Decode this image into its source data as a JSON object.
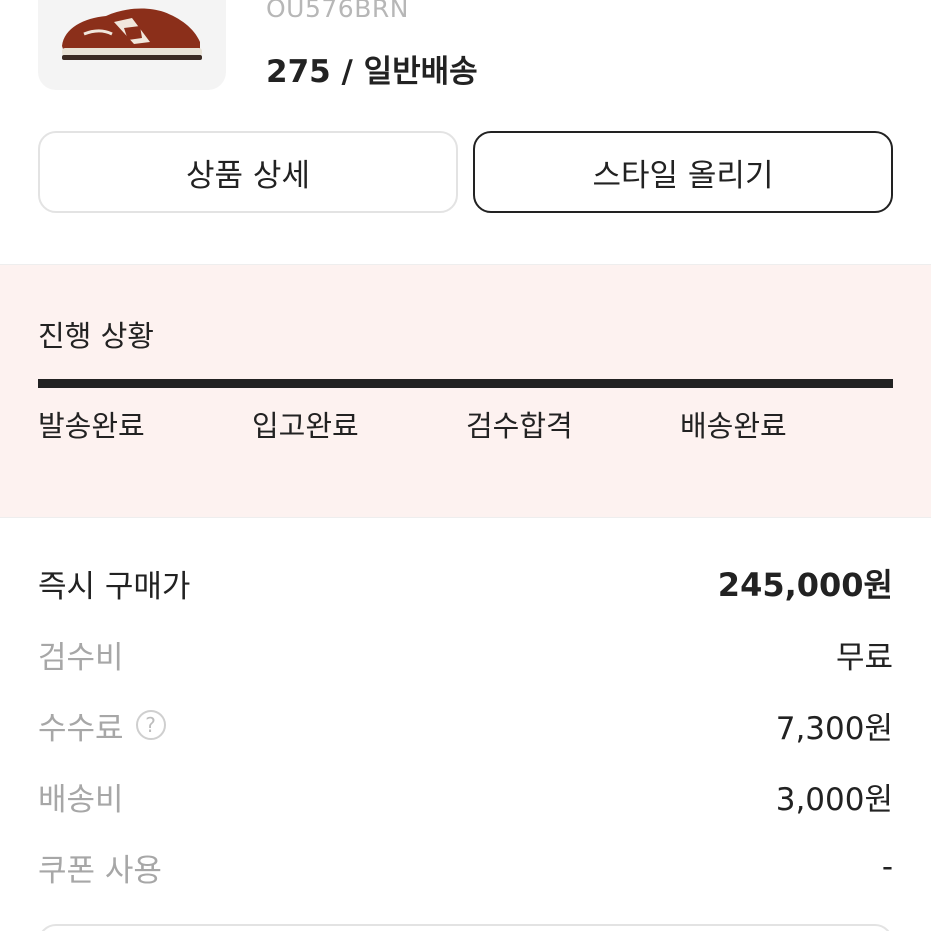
{
  "product": {
    "model_number": "OU576BRN",
    "size_shipping": "275 / 일반배송",
    "image_icon": "sneaker-image"
  },
  "buttons": {
    "detail_label": "상품 상세",
    "style_label": "스타일 올리기"
  },
  "progress": {
    "title": "진행 상황",
    "steps": [
      "발송완료",
      "입고완료",
      "검수합격",
      "배송완료"
    ],
    "completion": 1.0,
    "background_color": "#fdf2f0",
    "bar_color": "#222222"
  },
  "pricing": {
    "rows": [
      {
        "label": "즉시 구매가",
        "value": "245,000원"
      },
      {
        "label": "검수비",
        "value": "무료"
      },
      {
        "label": "수수료",
        "value": "7,300원",
        "icon": "help-icon",
        "icon_glyph": "?"
      },
      {
        "label": "배송비",
        "value": "3,000원"
      },
      {
        "label": "쿠폰 사용",
        "value": "-"
      }
    ]
  }
}
